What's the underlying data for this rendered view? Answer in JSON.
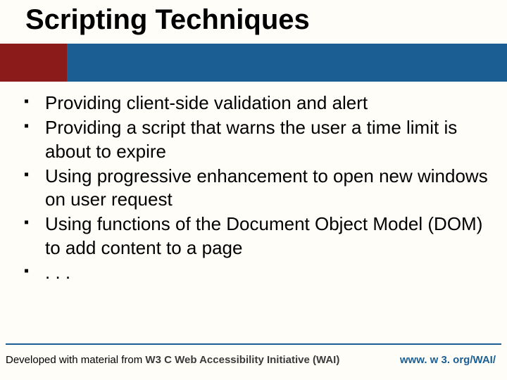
{
  "title": "Scripting Techniques",
  "bullets": [
    "Providing client-side validation and alert",
    "Providing a script that warns the user a time limit is about to expire",
    "Using progressive enhancement to open new windows on user request",
    "Using functions of the Document Object Model (DOM) to add content to a page",
    ". . ."
  ],
  "footer": {
    "prefix": "Developed with material from ",
    "source": "W3 C Web Accessibility Initiative (WAI)",
    "url": "www. w 3. org/WAI/"
  }
}
